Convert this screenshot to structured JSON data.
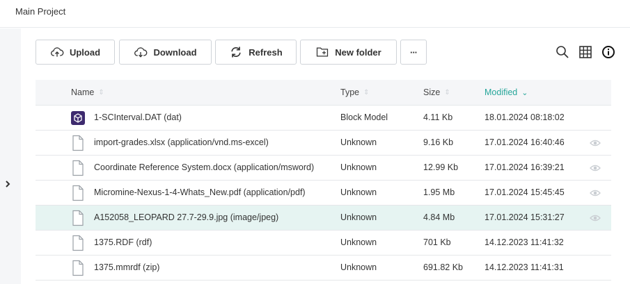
{
  "breadcrumb": {
    "title": "Main Project"
  },
  "toolbar": {
    "upload_label": "Upload",
    "download_label": "Download",
    "refresh_label": "Refresh",
    "new_folder_label": "New folder",
    "more_label": "···"
  },
  "table": {
    "headers": {
      "name": "Name",
      "type": "Type",
      "size": "Size",
      "modified": "Modified"
    },
    "sort": {
      "column": "Modified",
      "direction": "descending"
    },
    "rows": [
      {
        "name": "1-SCInterval.DAT (dat)",
        "type": "Block Model",
        "size": "4.11 Kb",
        "modified": "18.01.2024 08:18:02",
        "icon": "block-model-icon",
        "eye": false,
        "selected": false
      },
      {
        "name": "import-grades.xlsx (application/vnd.ms-excel)",
        "type": "Unknown",
        "size": "9.16 Kb",
        "modified": "17.01.2024 16:40:46",
        "icon": "file-icon",
        "eye": true,
        "selected": false
      },
      {
        "name": "Coordinate Reference System.docx (application/msword)",
        "type": "Unknown",
        "size": "12.99 Kb",
        "modified": "17.01.2024 16:39:21",
        "icon": "file-icon",
        "eye": true,
        "selected": false
      },
      {
        "name": "Micromine-Nexus-1-4-Whats_New.pdf (application/pdf)",
        "type": "Unknown",
        "size": "1.95 Mb",
        "modified": "17.01.2024 15:45:45",
        "icon": "file-icon",
        "eye": true,
        "selected": false
      },
      {
        "name": "A152058_LEOPARD 27.7-29.9.jpg (image/jpeg)",
        "type": "Unknown",
        "size": "4.84 Mb",
        "modified": "17.01.2024 15:31:27",
        "icon": "file-icon",
        "eye": true,
        "selected": true
      },
      {
        "name": "1375.RDF (rdf)",
        "type": "Unknown",
        "size": "701 Kb",
        "modified": "14.12.2023 11:41:32",
        "icon": "file-icon",
        "eye": false,
        "selected": false
      },
      {
        "name": "1375.mmrdf (zip)",
        "type": "Unknown",
        "size": "691.82 Kb",
        "modified": "14.12.2023 11:41:31",
        "icon": "file-icon",
        "eye": false,
        "selected": false
      }
    ]
  },
  "colors": {
    "accent": "#26a69a",
    "selected_row": "#e6f4f2",
    "block_model_icon": "#3d2a6e"
  }
}
